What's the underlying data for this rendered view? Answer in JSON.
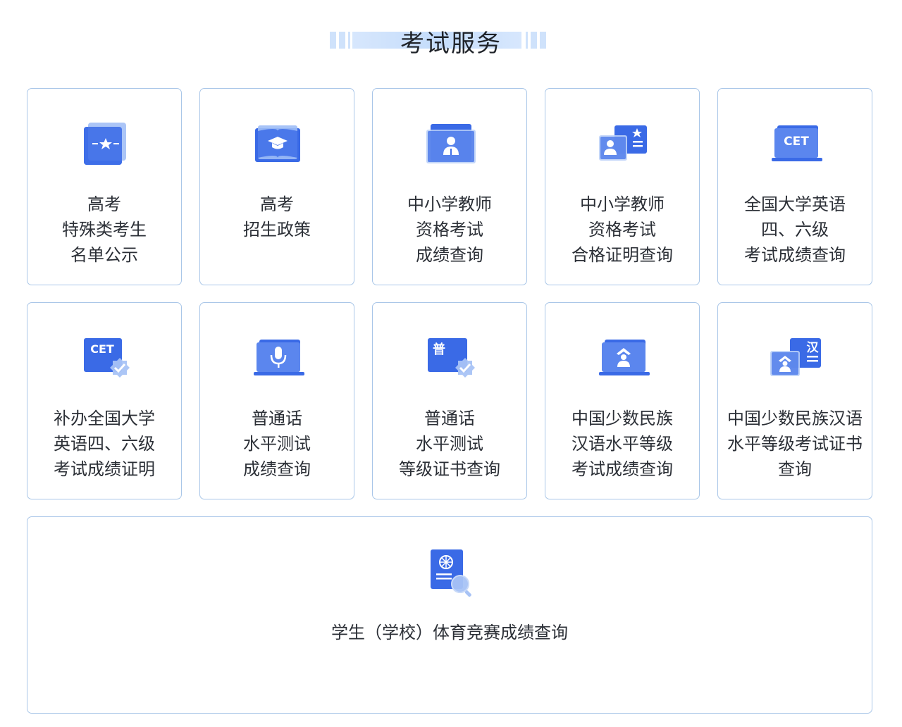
{
  "header": {
    "title": "考试服务"
  },
  "services": [
    {
      "label": "高考\n特殊类考生\n名单公示",
      "icon": "star-badge-icon"
    },
    {
      "label": "高考\n招生政策",
      "icon": "graduation-book-icon"
    },
    {
      "label": "中小学教师\n资格考试\n成绩查询",
      "icon": "teacher-profile-icon"
    },
    {
      "label": "中小学教师\n资格考试\n合格证明查询",
      "icon": "teacher-certificate-icon"
    },
    {
      "label": "全国大学英语\n四、六级\n考试成绩查询",
      "icon": "cet-laptop-icon",
      "icon_text": "CET"
    },
    {
      "label": "补办全国大学\n英语四、六级\n考试成绩证明",
      "icon": "cet-verified-icon",
      "icon_text": "CET"
    },
    {
      "label": "普通话\n水平测试\n成绩查询",
      "icon": "microphone-laptop-icon"
    },
    {
      "label": "普通话\n水平测试\n等级证书查询",
      "icon": "mandarin-verified-icon",
      "icon_text": "普"
    },
    {
      "label": "中国少数民族\n汉语水平等级\n考试成绩查询",
      "icon": "minority-laptop-icon"
    },
    {
      "label": "中国少数民族汉语\n水平等级考试证书\n查询",
      "icon": "chinese-certificate-icon",
      "icon_text": "汉"
    }
  ],
  "wide_service": {
    "label": "学生（学校）体育竞赛成绩查询",
    "icon": "sports-search-icon"
  },
  "colors": {
    "accent": "#3a6ae6",
    "accent_light": "#a8c3f5",
    "border": "#a9c6e8",
    "header_bar": "#cfe2fb"
  }
}
